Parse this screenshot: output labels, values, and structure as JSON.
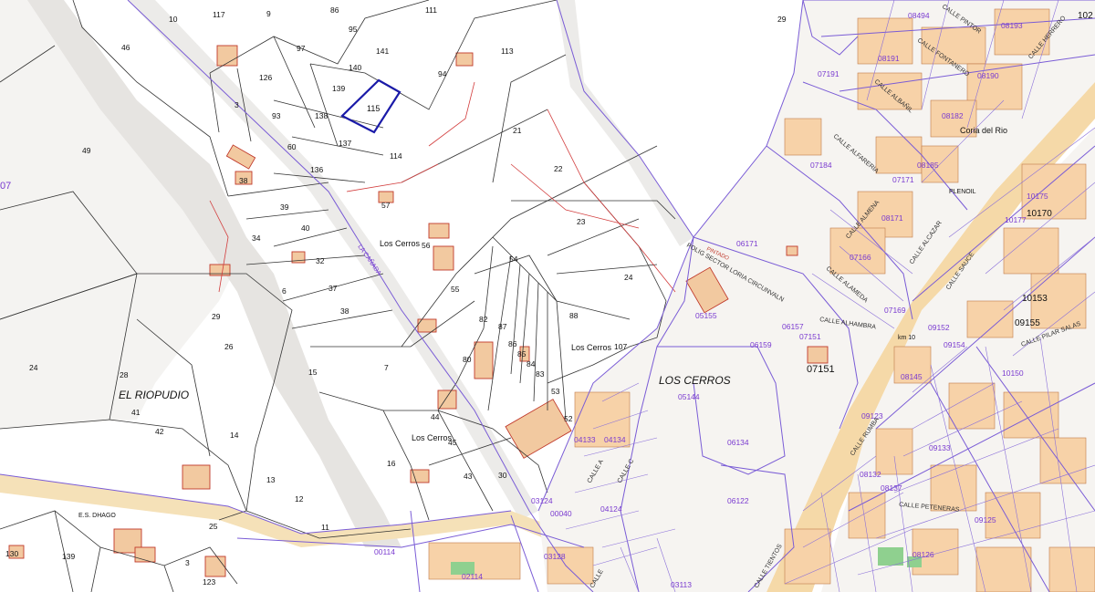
{
  "colors": {
    "road_fill": "#e8e6e3",
    "parcel_line": "#333333",
    "urban_line": "#7a5cd6",
    "building": "#f2c9a0",
    "building_edge": "#c0392b",
    "selected_parcel": "#1a1aa8",
    "highway": "#f5d9a8",
    "green": "#7cc47c",
    "black_label": "#111111",
    "purple_label": "#7a3bd0"
  },
  "selected_parcel_label": "115",
  "black_labels": {
    "n10": "10",
    "n117": "117",
    "n9": "9",
    "n86": "86",
    "n111": "111",
    "n29": "29",
    "n46": "46",
    "n95": "95",
    "n97": "97",
    "n141": "141",
    "n113": "113",
    "n126": "126",
    "n140": "140",
    "n94": "94",
    "n139": "139",
    "n3": "3",
    "n93": "93",
    "n138": "138",
    "n137": "137",
    "n60": "60",
    "n21": "21",
    "n49": "49",
    "n114": "114",
    "n136": "136",
    "n22": "22",
    "n38a": "38",
    "n57": "57",
    "n39": "39",
    "n40": "40",
    "n23": "23",
    "n34": "34",
    "n56": "56",
    "n24": "24",
    "n54": "54",
    "n32": "32",
    "n37": "37",
    "n55": "55",
    "n6": "6",
    "n38b": "38",
    "n88": "88",
    "n82": "82",
    "n87": "87",
    "n29b": "29",
    "n26": "26",
    "n86b": "86",
    "n85": "85",
    "n107": "107",
    "n80": "80",
    "n84": "84",
    "n24b": "24",
    "n28": "28",
    "n15": "15",
    "n7": "7",
    "n83": "83",
    "n53": "53",
    "n41": "41",
    "n42": "42",
    "n44": "44",
    "n52": "52",
    "n14": "14",
    "n45": "45",
    "n16": "16",
    "n43": "43",
    "n30": "30",
    "n13": "13",
    "n12": "12",
    "n11": "11",
    "n25": "25",
    "n139b": "139",
    "n3b": "3",
    "n123": "123",
    "n130": "130",
    "n7151": "07151"
  },
  "place_labels": {
    "los_cerros_1": "Los Cerros",
    "los_cerros_2": "Los Cerros",
    "los_cerros_3": "Los Cerros",
    "los_cerros_big": "LOS CERROS",
    "el_riopudio": "EL RIOPUDIO",
    "coria": "Coria del Rio",
    "es_dhago": "E.S. DHAGO",
    "plenoil": "PLENOIL",
    "pintado": "PINTADO",
    "km10": "km 10",
    "big_10170": "10170",
    "big_10153": "10153",
    "big_09155": "09155",
    "corner_102": "102"
  },
  "purple_labels": {
    "p08494": "08494",
    "p08193": "08193",
    "p08191": "08191",
    "p08190": "08190",
    "p07191": "07191",
    "p08182": "08182",
    "p07184": "07184",
    "p08185": "08185",
    "p08171": "08171",
    "p07171": "07171",
    "p06171": "06171",
    "p07166": "07166",
    "p10175": "10175",
    "p10177": "10177",
    "p05155": "05155",
    "p07169": "07169",
    "p06157": "06157",
    "p07151": "07151",
    "p06159": "06159",
    "p09152": "09152",
    "p09154": "09154",
    "p08145": "08145",
    "p10150": "10150",
    "p05144": "05144",
    "p06134": "06134",
    "p09133": "09133",
    "p04133": "04133",
    "p04134": "04134",
    "p08132": "08132",
    "p06122": "06122",
    "p04124": "04124",
    "p03124": "03124",
    "p09125": "09125",
    "p08126": "08126",
    "p03128": "03128",
    "p00114": "00114",
    "p02114": "02114",
    "p03113": "03113",
    "p00040": "00040",
    "p07": "07",
    "p09123": "09123",
    "p08137": "08137"
  },
  "street_labels": {
    "calle_pintor": "CALLE PINTOR",
    "calle_fontanero": "CALLE FONTANERO",
    "calle_albanil": "CALLE ALBAÑIL",
    "calle_herrero": "CALLE HERRERO",
    "calle_alfareria": "CALLE ALFARERIA",
    "calle_alameda": "CALLE ALAMEDA",
    "calle_almena": "CALLE ALMENA",
    "calle_alcazar": "CALLE ALCAZAR",
    "calle_alhambra": "CALLE ALHAMBRA",
    "calle_sauce": "CALLE SAUCE",
    "calle_pilar_salas": "CALLE PILAR SALAS",
    "calle_rumba": "CALLE RUMBA",
    "calle_peteneras": "CALLE PETENERAS",
    "calle_tientos": "CALLE TIENTOS",
    "calle_a": "CALLE A",
    "calle_c": "CALLE C",
    "calle_e": "CALLE",
    "poligono": "POLIG SECTOR LORIA CIRCUNVALN",
    "n_lbl": "LA CAÑADA"
  }
}
